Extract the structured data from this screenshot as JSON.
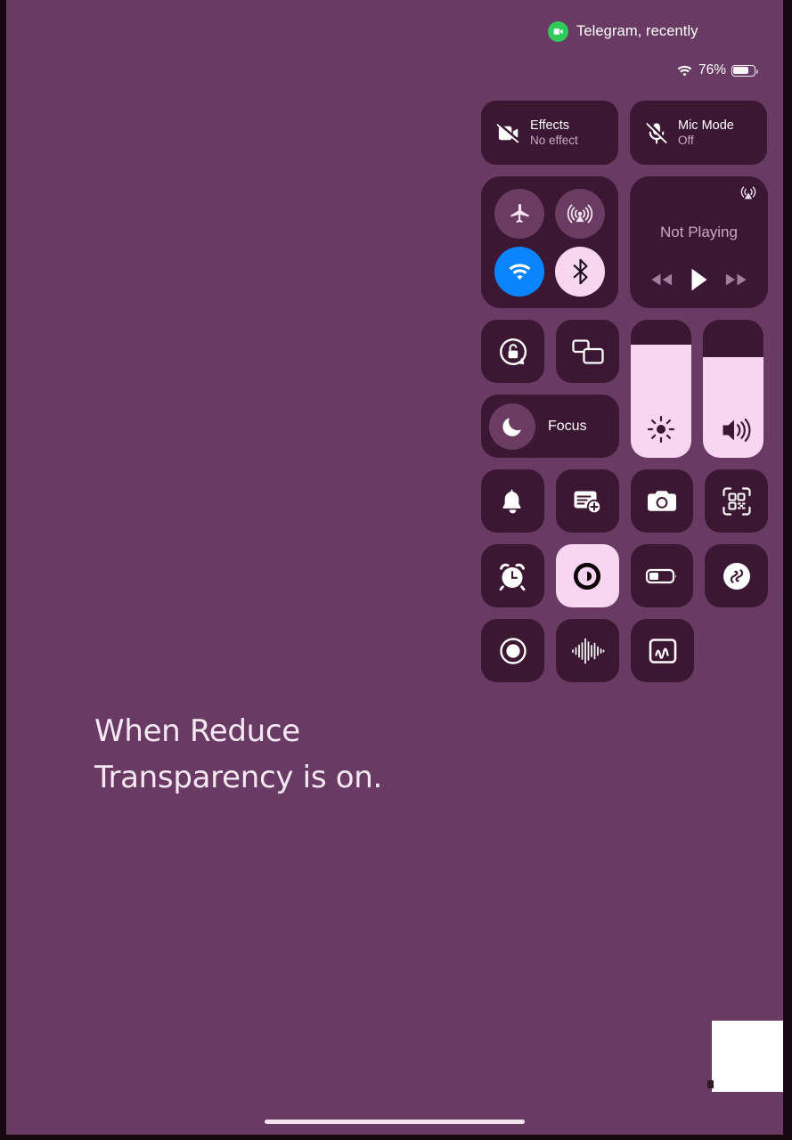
{
  "device": {
    "wallpaper_color": "#693A63",
    "tile_color": "#3B1733",
    "accent_active": "#F8D6F2",
    "wifi_on_color": "#0A84FF"
  },
  "status_bar": {
    "camera_indicator": {
      "icon": "video-camera-icon",
      "text": "Telegram, recently",
      "dot_color": "#2ECB5B"
    },
    "wifi_icon": "wifi-icon",
    "battery_percent_label": "76%",
    "battery_level": 76
  },
  "control_center": {
    "video_conference": [
      {
        "icon": "video-camera-slash-icon",
        "title": "Effects",
        "subtitle": "No effect"
      },
      {
        "icon": "microphone-slash-icon",
        "title": "Mic Mode",
        "subtitle": "Off"
      }
    ],
    "connectivity": [
      {
        "name": "airplane-mode",
        "icon": "airplane-icon",
        "state": "off"
      },
      {
        "name": "airdrop",
        "icon": "airdrop-icon",
        "state": "off"
      },
      {
        "name": "wifi",
        "icon": "wifi-icon",
        "state": "on"
      },
      {
        "name": "bluetooth",
        "icon": "bluetooth-icon",
        "state": "on"
      }
    ],
    "media": {
      "title": "Not Playing",
      "airplay_icon": "airplay-audio-icon",
      "controls": [
        "rewind-icon",
        "play-icon",
        "fast-forward-icon"
      ]
    },
    "toggles_small": [
      {
        "name": "rotation-lock",
        "icon": "rotation-lock-open-icon",
        "state": "off"
      },
      {
        "name": "screen-mirroring",
        "icon": "screen-mirroring-icon",
        "state": "off"
      }
    ],
    "focus": {
      "label": "Focus",
      "icon": "crescent-moon-icon",
      "state": "off"
    },
    "sliders": [
      {
        "name": "brightness",
        "icon": "brightness-sun-icon",
        "value": 82
      },
      {
        "name": "volume",
        "icon": "speaker-waves-icon",
        "value": 73
      }
    ],
    "grid": [
      [
        {
          "name": "silent-mode",
          "icon": "bell-icon",
          "state": "off"
        },
        {
          "name": "quick-note",
          "icon": "note-plus-icon",
          "state": "off"
        },
        {
          "name": "camera",
          "icon": "camera-icon",
          "state": "off"
        },
        {
          "name": "code-scanner",
          "icon": "qr-code-icon",
          "state": "off"
        }
      ],
      [
        {
          "name": "alarm",
          "icon": "alarm-clock-icon",
          "state": "off"
        },
        {
          "name": "dark-mode",
          "icon": "dark-mode-circle-icon",
          "state": "on"
        },
        {
          "name": "low-power-mode",
          "icon": "battery-low-icon",
          "state": "off"
        },
        {
          "name": "shazam",
          "icon": "shazam-icon",
          "state": "off"
        }
      ],
      [
        {
          "name": "screen-recording",
          "icon": "record-circle-icon",
          "state": "off"
        },
        {
          "name": "voice-memos",
          "icon": "waveform-icon",
          "state": "off"
        },
        {
          "name": "freeform",
          "icon": "freeform-scribble-icon",
          "state": "off"
        }
      ]
    ]
  },
  "caption": {
    "line1": "When Reduce",
    "line2": "Transparency is on."
  }
}
